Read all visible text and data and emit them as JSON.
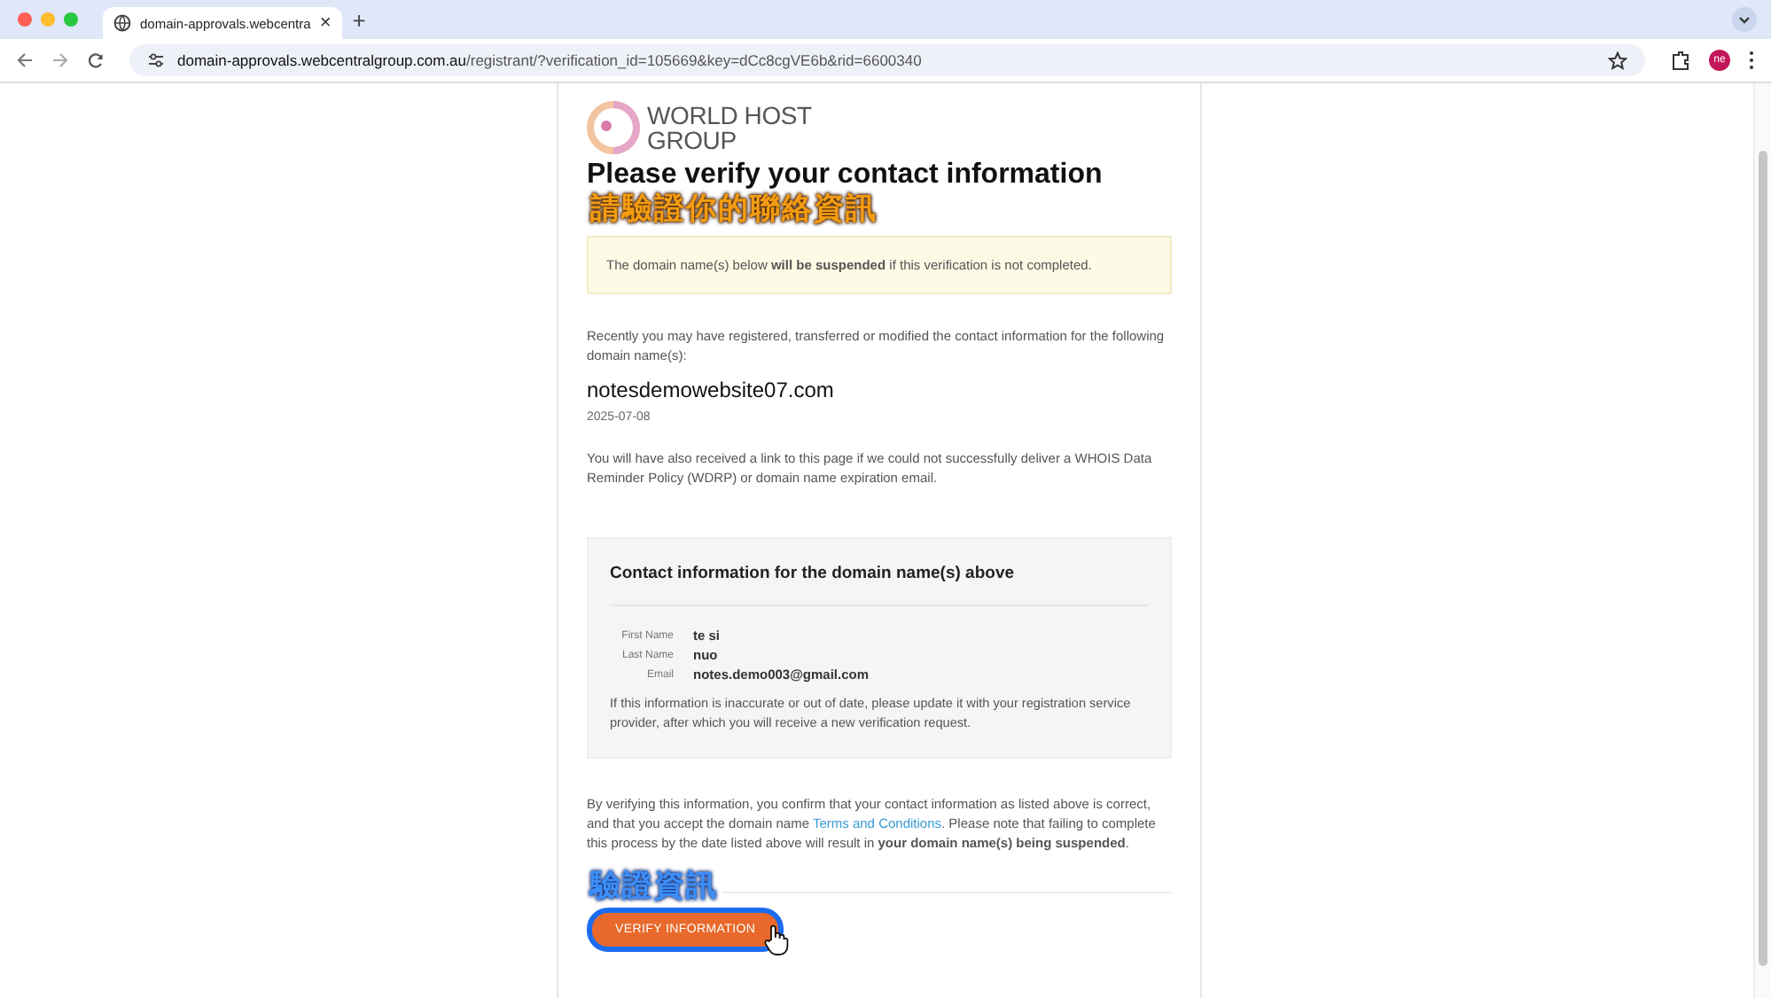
{
  "browser": {
    "tab_title": "domain-approvals.webcentra",
    "tab_close": "×",
    "new_tab": "+",
    "url_host": "domain-approvals.webcentralgroup.com.au",
    "url_path": "/registrant/?verification_id=105669&key=dCc8cgVE6b&rid=6600340",
    "profile": "ne"
  },
  "logo": {
    "line_1": "WORLD HOST",
    "line_2": "GROUP"
  },
  "heading": "Please verify your contact information",
  "heading_annotation": "請驗證你的聯絡資訊",
  "alert": "The domain name(s) below **will be suspended** if this verification is not completed.",
  "intro": "Recently you may have registered, transferred or modified the contact information for the following domain name(s):",
  "domain": "notesdemowebsite07.com",
  "date": "2025-07-08",
  "notice": "You will have also received a link to this page if we could not successfully deliver a WHOIS Data Reminder Policy (WDRP) or domain name expiration email.",
  "contact": {
    "title": "Contact information for the domain name(s) above",
    "fields": [
      {
        "label": "First Name",
        "value": "te si"
      },
      {
        "label": "Last Name",
        "value": "nuo"
      },
      {
        "label": "Email",
        "value": "notes.demo003@gmail.com"
      }
    ],
    "note": "If this information is inaccurate or out of date, please update it with your registration service provider, after which you will receive a new verification request."
  },
  "consent": {
    "before": "By verifying this information, you confirm that your contact information as listed above is correct, and that you accept the domain name",
    "link": "Terms and Conditions",
    "after": ". Please note that failing to complete this process by the date listed above will result in **your domain name(s) being suspended**."
  },
  "button_annotation": "驗證資訊",
  "verify_button": "VERIFY INFORMATION"
}
